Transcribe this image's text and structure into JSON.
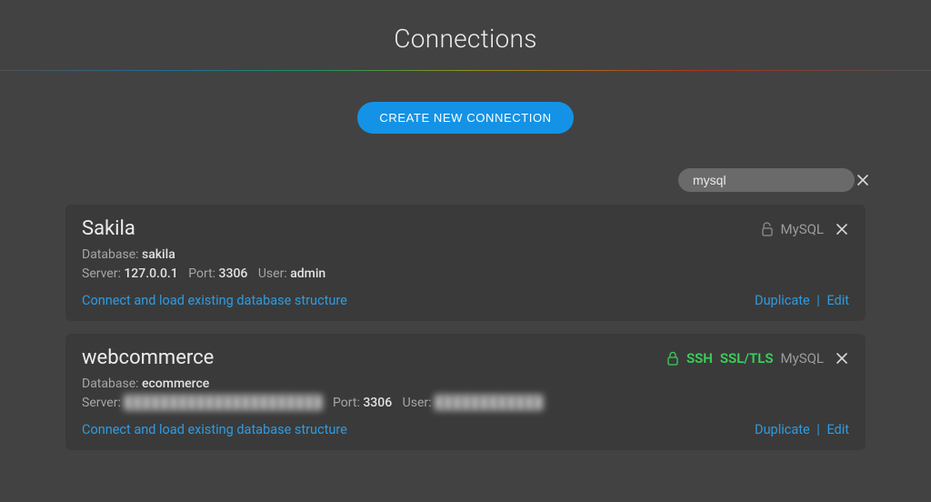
{
  "title": "Connections",
  "create_button": "CREATE NEW CONNECTION",
  "search": {
    "value": "mysql"
  },
  "labels": {
    "database": "Database:",
    "server": "Server:",
    "port": "Port:",
    "user": "User:",
    "connect_link": "Connect and load existing database structure",
    "duplicate": "Duplicate",
    "edit": "Edit",
    "ssh": "SSH",
    "ssltls": "SSL/TLS"
  },
  "connections": [
    {
      "name": "Sakila",
      "dbtype": "MySQL",
      "secure": false,
      "ssh": false,
      "ssl": false,
      "database": "sakila",
      "server": "127.0.0.1",
      "server_hidden": false,
      "port": "3306",
      "user": "admin",
      "user_hidden": false
    },
    {
      "name": "webcommerce",
      "dbtype": "MySQL",
      "secure": true,
      "ssh": true,
      "ssl": true,
      "database": "ecommerce",
      "server": "██████████████████████",
      "server_hidden": true,
      "port": "3306",
      "user": "████████████",
      "user_hidden": true
    }
  ]
}
